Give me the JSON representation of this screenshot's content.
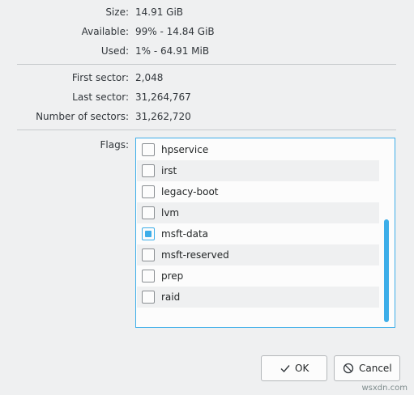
{
  "info": {
    "size": {
      "label": "Size:",
      "value": "14.91 GiB"
    },
    "available": {
      "label": "Available:",
      "value": "99% - 14.84 GiB"
    },
    "used": {
      "label": "Used:",
      "value": "1% - 64.91 MiB"
    },
    "first_sector": {
      "label": "First sector:",
      "value": "2,048"
    },
    "last_sector": {
      "label": "Last sector:",
      "value": "31,264,767"
    },
    "num_sectors": {
      "label": "Number of sectors:",
      "value": "31,262,720"
    }
  },
  "flags": {
    "label": "Flags:",
    "items": [
      {
        "name": "hpservice",
        "checked": false
      },
      {
        "name": "irst",
        "checked": false
      },
      {
        "name": "legacy-boot",
        "checked": false
      },
      {
        "name": "lvm",
        "checked": false
      },
      {
        "name": "msft-data",
        "checked": true
      },
      {
        "name": "msft-reserved",
        "checked": false
      },
      {
        "name": "prep",
        "checked": false
      },
      {
        "name": "raid",
        "checked": false
      }
    ]
  },
  "buttons": {
    "ok": {
      "label": "OK",
      "icon": "checkmark-icon"
    },
    "cancel": {
      "label": "Cancel",
      "icon": "cancel-circle-icon"
    }
  },
  "watermark": "wsxdn.com",
  "colors": {
    "accent": "#3daee9",
    "background": "#eff0f1",
    "separator": "#c7cacc"
  }
}
